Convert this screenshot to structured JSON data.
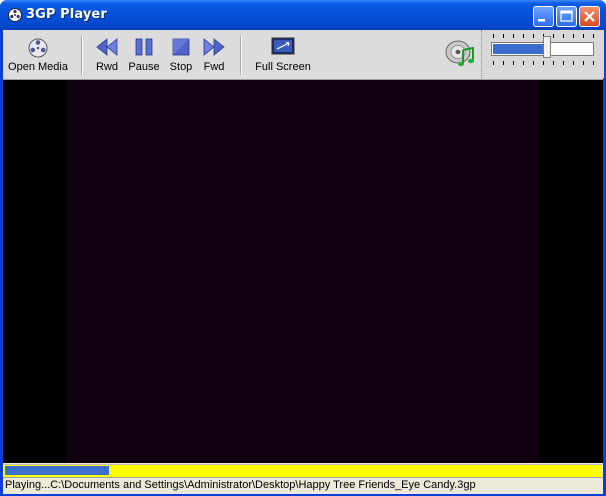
{
  "window": {
    "title": "3GP Player"
  },
  "toolbar": {
    "open_media": "Open Media",
    "rwd": "Rwd",
    "pause": "Pause",
    "stop": "Stop",
    "fwd": "Fwd",
    "full_screen": "Full Screen"
  },
  "volume": {
    "level": 0.55
  },
  "playback": {
    "progress": 0.175
  },
  "status": {
    "text": "Playing...C:\\Documents and Settings\\Administrator\\Desktop\\Happy Tree Friends_Eye Candy.3gp"
  },
  "colors": {
    "title_bar": "#0a5be6",
    "progress_bg": "#ffff00",
    "progress_fill": "#3a6fd0",
    "video_bg": "#11010f"
  },
  "icons": [
    "app-icon",
    "open-media-icon",
    "rewind-icon",
    "pause-icon",
    "stop-icon",
    "forward-icon",
    "full-screen-icon",
    "music-disc-icon"
  ]
}
